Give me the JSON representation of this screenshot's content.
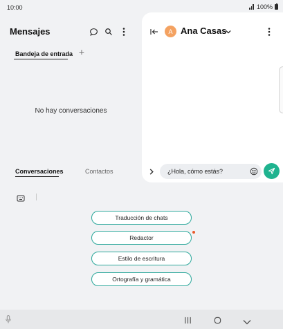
{
  "status": {
    "time": "10:00",
    "battery": "100%"
  },
  "left": {
    "title": "Mensajes",
    "tab_inbox": "Bandeja de entrada",
    "add": "+",
    "empty": "No hay conversaciones",
    "tabs": [
      "Conversaciones",
      "Contactos"
    ]
  },
  "chat": {
    "contact_initial": "A",
    "contact_name": "Ana Casas",
    "input_value": "¿Hola, cómo estás?"
  },
  "ai_tools": [
    "Traducción de chats",
    "Redactor",
    "Estilo de escritura",
    "Ortografía y gramática"
  ],
  "colors": {
    "accent": "#1fb38f",
    "avatar": "#f4a261",
    "pill_border": "#2aa79a",
    "dot": "#e85a2a"
  }
}
